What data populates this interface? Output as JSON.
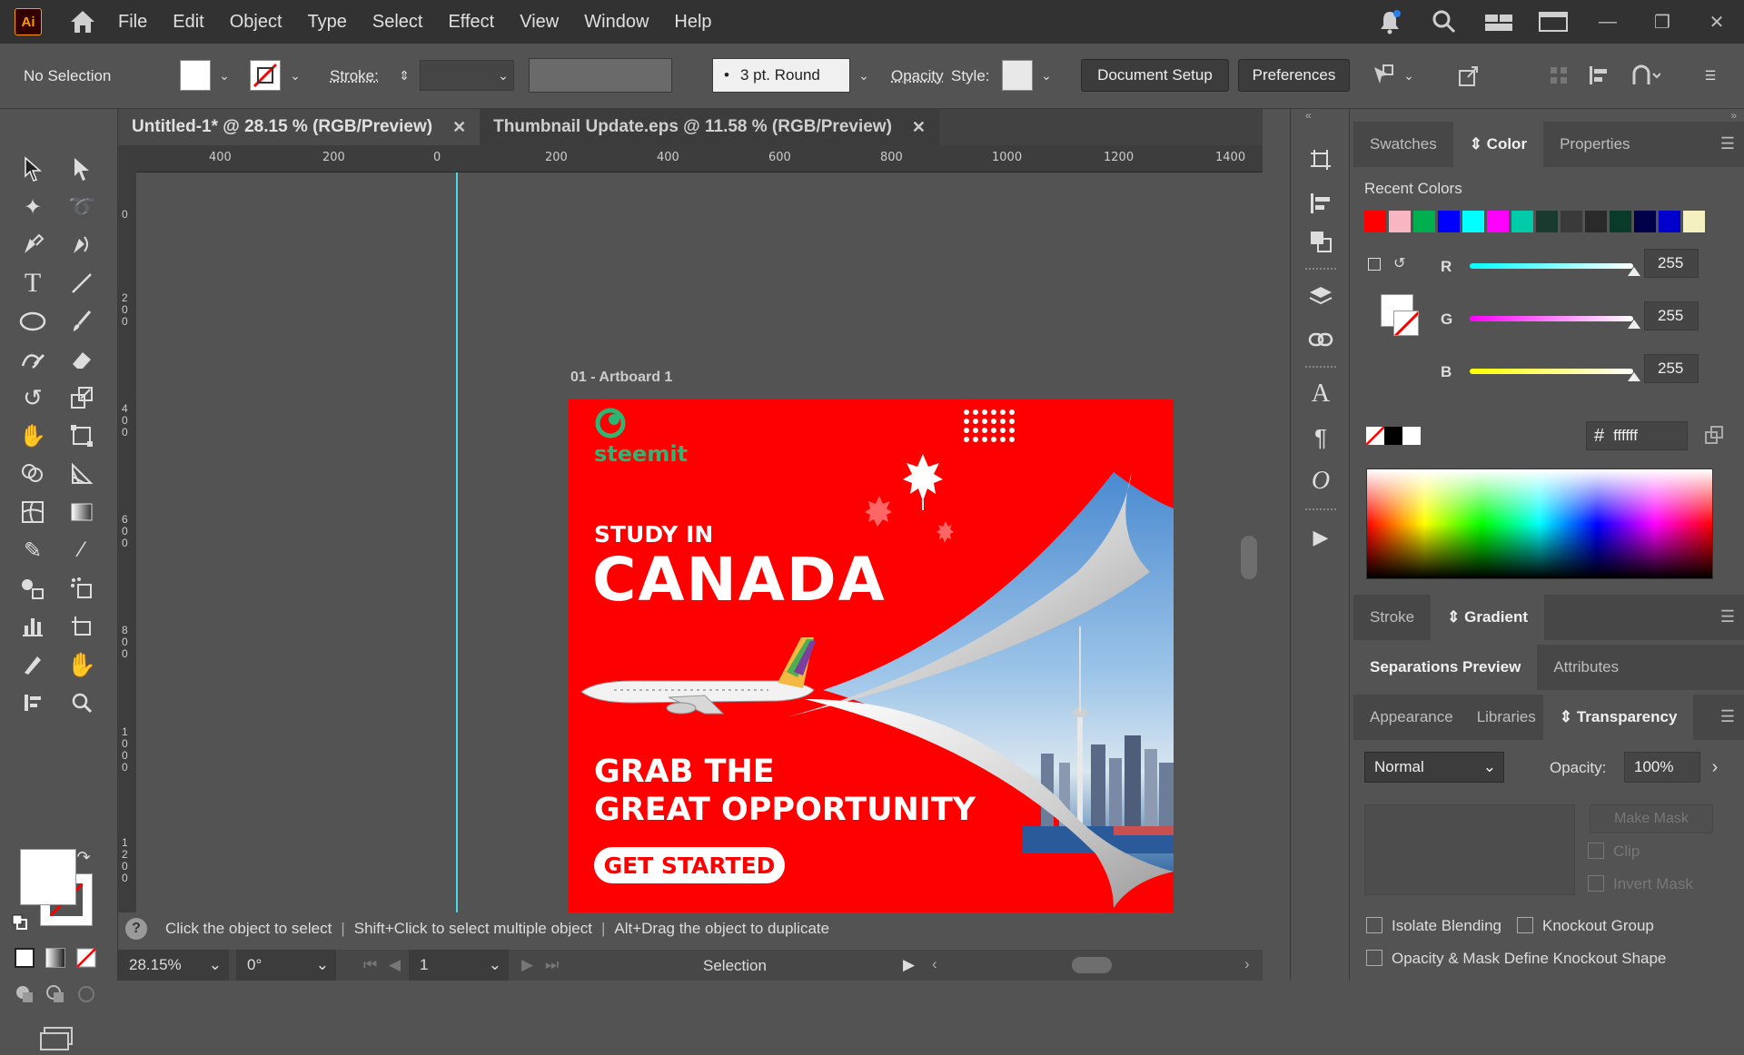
{
  "app": {
    "logo": "Ai"
  },
  "menu": [
    "File",
    "Edit",
    "Object",
    "Type",
    "Select",
    "Effect",
    "View",
    "Window",
    "Help"
  ],
  "control": {
    "selection": "No Selection",
    "stroke_label": "Stroke:",
    "brush": "3 pt. Round",
    "opacity_label": "Opacity",
    "style_label": "Style:",
    "document_setup": "Document Setup",
    "preferences": "Preferences"
  },
  "tabs": [
    {
      "label": "Untitled-1* @ 28.15 % (RGB/Preview)",
      "active": true
    },
    {
      "label": "Thumbnail Update.eps @ 11.58 % (RGB/Preview)",
      "active": false
    }
  ],
  "ruler": {
    "h": [
      "400",
      "200",
      "0",
      "200",
      "400",
      "600",
      "800",
      "1000",
      "1200",
      "1400"
    ],
    "v": [
      "0",
      "2\n0\n0",
      "4\n0\n0",
      "6\n0\n0",
      "8\n0\n0",
      "1\n0\n0\n0",
      "1\n2\n0\n0"
    ]
  },
  "artboard": {
    "label": "01 - Artboard 1",
    "brand": "steemit",
    "study_in": "STUDY IN",
    "country": "CANADA",
    "grab_1": "GRAB THE",
    "grab_2": "GREAT OPPORTUNITY",
    "cta": "GET STARTED"
  },
  "status": {
    "hint_1": "Click the object to select",
    "hint_2": "Shift+Click to select multiple object",
    "hint_3": "Alt+Drag the object to duplicate",
    "zoom": "28.15%",
    "rotation": "0°",
    "artboard_num": "1",
    "tool": "Selection"
  },
  "color_panel": {
    "tabs": [
      "Swatches",
      "Color",
      "Properties"
    ],
    "recent_label": "Recent Colors",
    "recent_colors": [
      "#ff0000",
      "#f7b6c2",
      "#00b050",
      "#0000ff",
      "#00ffff",
      "#ff00ff",
      "#00ccaa",
      "#1a3a30",
      "#3a3a3a",
      "#2a2a2a",
      "#0a3a2a",
      "#00004a",
      "#0000cc",
      "#f5f0c0"
    ],
    "r_label": "R",
    "r_value": "255",
    "g_label": "G",
    "g_value": "255",
    "b_label": "B",
    "b_value": "255",
    "hex_symbol": "#",
    "hex_value": "ffffff"
  },
  "stroke_gradient_tabs": [
    "Stroke",
    "Gradient"
  ],
  "sep_tabs": [
    "Separations Preview",
    "Attributes"
  ],
  "transparency": {
    "tabs": [
      "Appearance",
      "Libraries",
      "Transparency"
    ],
    "blend_mode": "Normal",
    "opacity_label": "Opacity:",
    "opacity_value": "100%",
    "make_mask": "Make Mask",
    "clip": "Clip",
    "invert_mask": "Invert Mask",
    "isolate": "Isolate Blending",
    "knockout": "Knockout Group",
    "opacity_mask": "Opacity & Mask Define Knockout Shape"
  }
}
